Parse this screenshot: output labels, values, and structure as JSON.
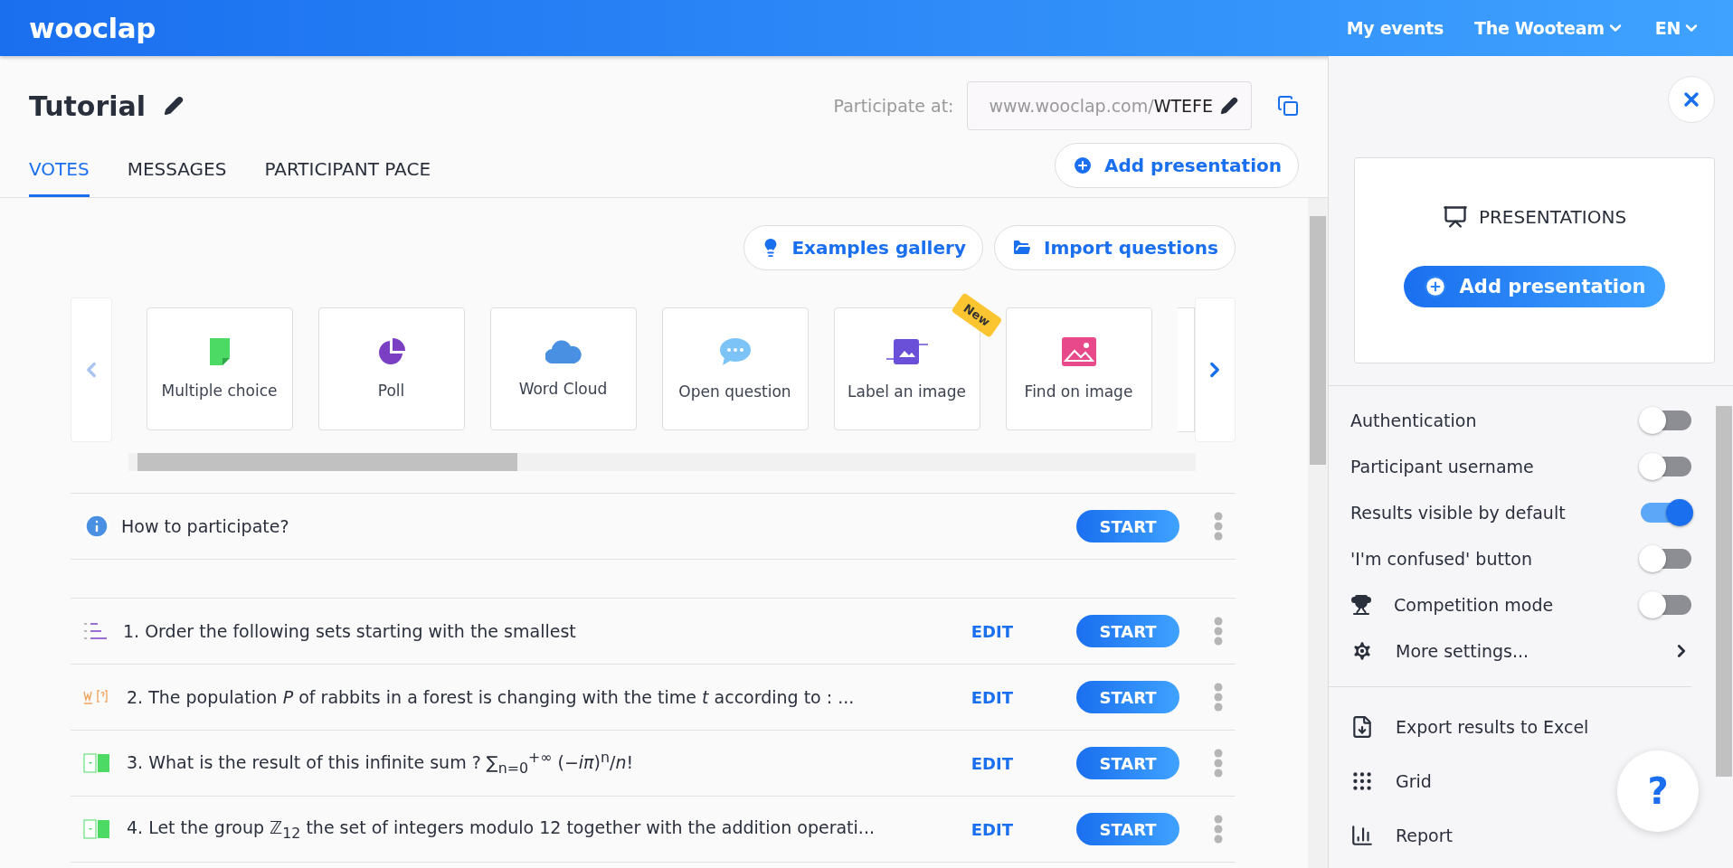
{
  "header": {
    "logo": "wooclap",
    "nav": [
      {
        "label": "My events",
        "dropdown": false
      },
      {
        "label": "The Wooteam",
        "dropdown": true
      },
      {
        "label": "EN",
        "dropdown": true
      }
    ]
  },
  "event": {
    "title": "Tutorial",
    "participate_label": "Participate at:",
    "url_prefix": "www.wooclap.com/",
    "code": "WTEFE"
  },
  "tabs": [
    {
      "label": "VOTES",
      "selected": true
    },
    {
      "label": "MESSAGES",
      "selected": false
    },
    {
      "label": "PARTICIPANT PACE",
      "selected": false
    }
  ],
  "add_presentation": "Add presentation",
  "actions": [
    {
      "kind": "bulb",
      "label": "Examples gallery"
    },
    {
      "kind": "folder",
      "label": "Import questions"
    }
  ],
  "question_types": [
    {
      "kind": "multiple",
      "label": "Multiple choice"
    },
    {
      "kind": "poll",
      "label": "Poll"
    },
    {
      "kind": "cloud",
      "label": "Word Cloud"
    },
    {
      "kind": "open",
      "label": "Open question"
    },
    {
      "kind": "label",
      "label": "Label an image",
      "badge": "New"
    },
    {
      "kind": "find",
      "label": "Find on image"
    }
  ],
  "intro": {
    "label": "How to participate?",
    "start": "START"
  },
  "questions": [
    {
      "kind": "order",
      "text": "1.  Order the following sets starting with the smallest",
      "edit": "EDIT",
      "start": "START"
    },
    {
      "kind": "fill",
      "text": "2.  The population *P* of rabbits in a forest is changing with the time *t* according to : ...",
      "edit": "EDIT",
      "start": "START"
    },
    {
      "kind": "match",
      "text": "3.  What is the result of this infinite sum ? ∑$_{n=0}$$^{+∞}$ (−*iπ*)$^{n}$/*n*!",
      "edit": "EDIT",
      "start": "START"
    },
    {
      "kind": "match",
      "text": "4.  Let the group ℤ$_{12}$ the set of integers modulo 12 together with the addition operati...",
      "edit": "EDIT",
      "start": "START"
    }
  ],
  "panel": {
    "presentations_title": "PRESENTATIONS",
    "add_presentation": "Add presentation",
    "settings": [
      {
        "kind": "toggle",
        "label": "Authentication",
        "on": false
      },
      {
        "kind": "toggle",
        "label": "Participant username",
        "on": false
      },
      {
        "kind": "toggle",
        "label": "Results visible by default",
        "on": true
      },
      {
        "kind": "toggle",
        "label": "'I'm confused' button",
        "on": false
      },
      {
        "kind": "trophy",
        "label": "Competition mode",
        "on": false
      },
      {
        "kind": "more",
        "label": "More settings..."
      }
    ],
    "exports": [
      {
        "kind": "export",
        "label": "Export results to Excel"
      },
      {
        "kind": "grid",
        "label": "Grid"
      },
      {
        "kind": "report",
        "label": "Report"
      }
    ],
    "help": "?"
  }
}
